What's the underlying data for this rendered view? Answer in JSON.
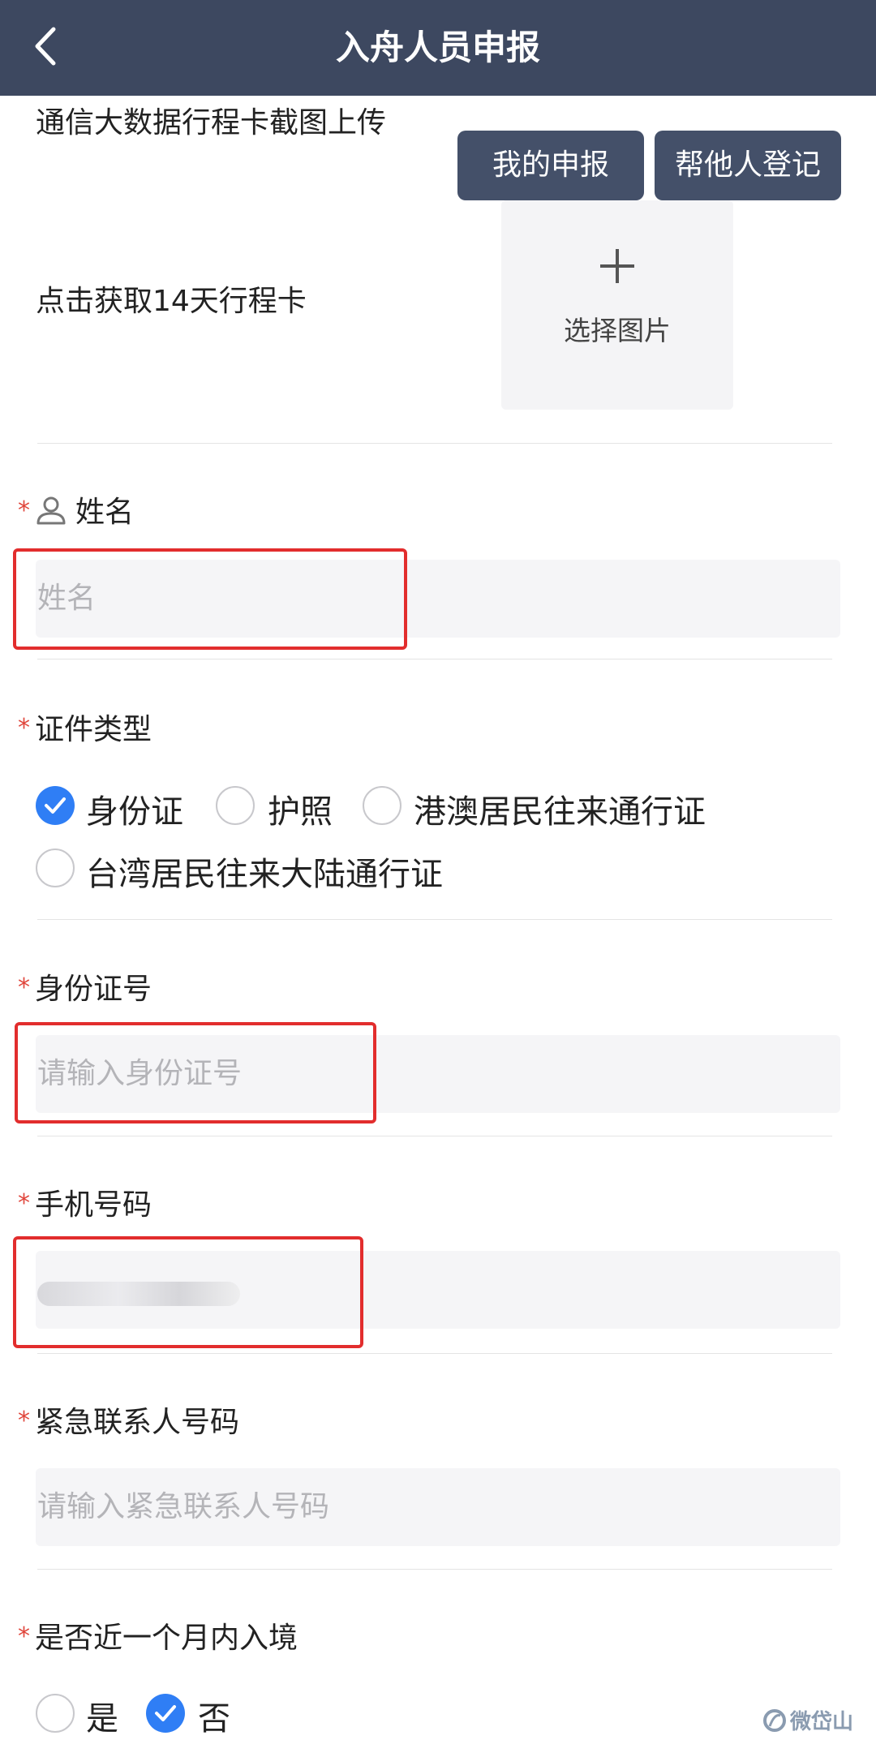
{
  "header": {
    "title": "入舟人员申报"
  },
  "upload": {
    "label": "通信大数据行程卡截图上传",
    "fetch_label": "点击获取14天行程卡",
    "picker_label": "选择图片"
  },
  "actions": {
    "my_report": "我的申报",
    "register_others": "帮他人登记"
  },
  "required_mark": "*",
  "name_field": {
    "label": "姓名",
    "placeholder": "姓名"
  },
  "id_type": {
    "label": "证件类型",
    "options": [
      {
        "label": "身份证",
        "selected": true
      },
      {
        "label": "护照",
        "selected": false
      },
      {
        "label": "港澳居民往来通行证",
        "selected": false
      },
      {
        "label": "台湾居民往来大陆通行证",
        "selected": false
      }
    ]
  },
  "id_number": {
    "label": "身份证号",
    "placeholder": "请输入身份证号"
  },
  "phone": {
    "label": "手机号码"
  },
  "emergency": {
    "label": "紧急联系人号码",
    "placeholder": "请输入紧急联系人号码"
  },
  "entry": {
    "label": "是否近一个月内入境",
    "options": [
      {
        "label": "是",
        "selected": false
      },
      {
        "label": "否",
        "selected": true
      }
    ]
  },
  "colors": {
    "header_bg": "#3d4860",
    "button_bg": "#445069",
    "accent": "#2f7ef5",
    "required": "#e0463c",
    "highlight": "#e22d2d"
  },
  "watermark": {
    "text": "微岱山"
  }
}
